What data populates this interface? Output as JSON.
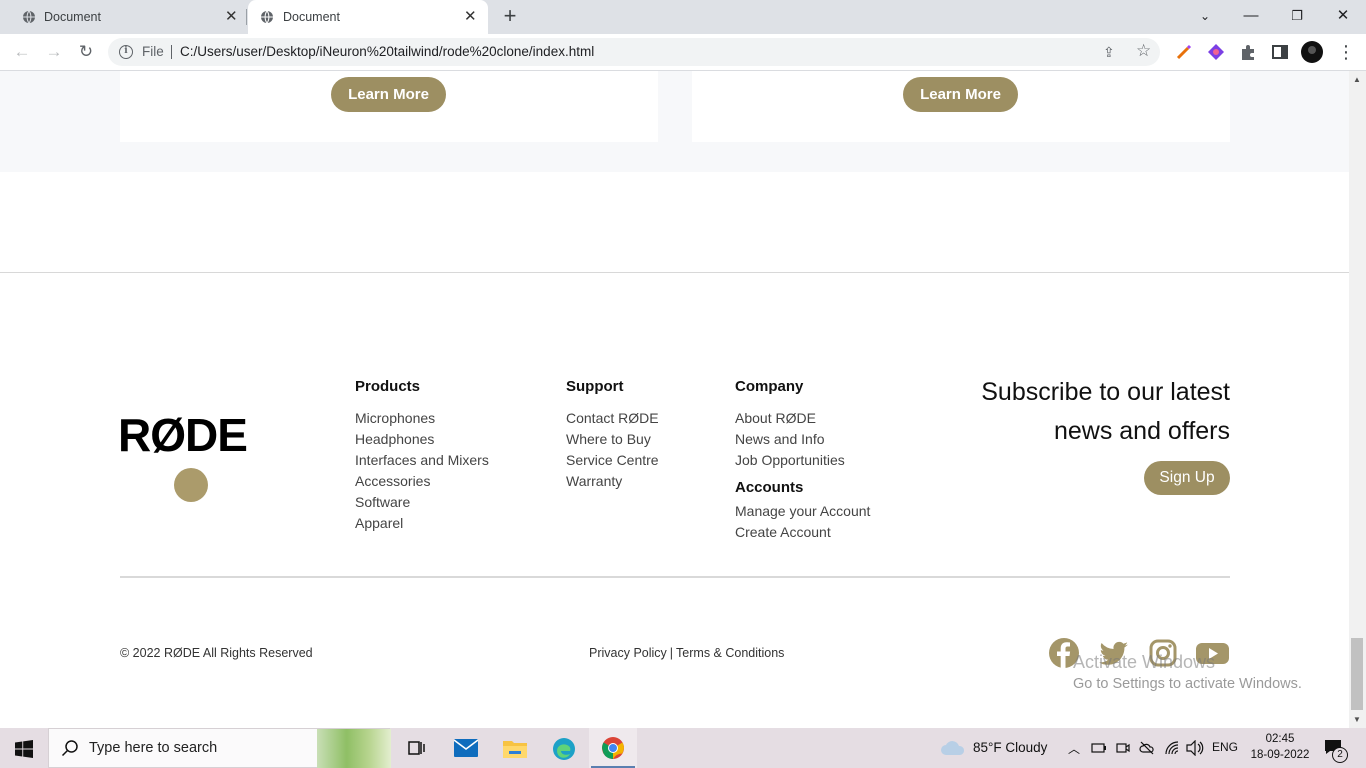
{
  "browser": {
    "tabs": [
      {
        "title": "Document"
      },
      {
        "title": "Document"
      }
    ],
    "address": {
      "scheme_label": "File",
      "url": "C:/Users/user/Desktop/iNeuron%20tailwind/rode%20clone/index.html"
    }
  },
  "cards": [
    {
      "button_label": "Learn More"
    },
    {
      "button_label": "Learn More"
    }
  ],
  "footer": {
    "logo_text": "RØDE",
    "columns": {
      "products": {
        "title": "Products",
        "links": [
          "Microphones",
          "Headphones",
          "Interfaces and Mixers",
          "Accessories",
          "Software",
          "Apparel"
        ]
      },
      "support": {
        "title": "Support",
        "links": [
          "Contact RØDE",
          "Where to Buy",
          "Service Centre",
          "Warranty"
        ]
      },
      "company": {
        "title": "Company",
        "links": [
          "About RØDE",
          "News and Info",
          "Job Opportunities"
        ]
      },
      "accounts": {
        "title": "Accounts",
        "links": [
          "Manage your Account",
          "Create Account"
        ]
      }
    },
    "subscribe": {
      "heading_line1": "Subscribe to our latest",
      "heading_line2": "news and offers",
      "button_label": "Sign Up"
    },
    "copyright": "© 2022 RØDE All Rights Reserved",
    "legal": {
      "privacy": "Privacy Policy",
      "separator": "|",
      "terms": "Terms & Conditions"
    },
    "social_icons": [
      "facebook-icon",
      "twitter-icon",
      "instagram-icon",
      "youtube-icon"
    ]
  },
  "watermark": {
    "line1": "Activate Windows",
    "line2": "Go to Settings to activate Windows."
  },
  "taskbar": {
    "search_placeholder": "Type here to search",
    "weather": "85°F  Cloudy",
    "language": "ENG",
    "time": "02:45",
    "date": "18-09-2022",
    "notification_count": "2"
  },
  "colors": {
    "accent": "#9d8f62",
    "logo_dot": "#ab9b6b",
    "social_icon": "#a49669"
  }
}
